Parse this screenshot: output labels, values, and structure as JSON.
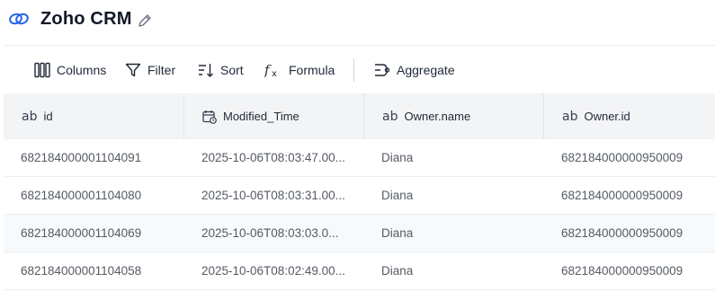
{
  "app": {
    "title": "Zoho CRM"
  },
  "toolbar": {
    "columns_label": "Columns",
    "filter_label": "Filter",
    "sort_label": "Sort",
    "formula_label": "Formula",
    "aggregate_label": "Aggregate"
  },
  "table": {
    "columns": [
      {
        "type": "ab",
        "label": "id"
      },
      {
        "type": "datetime",
        "label": "Modified_Time"
      },
      {
        "type": "ab",
        "label": "Owner.name"
      },
      {
        "type": "ab",
        "label": "Owner.id"
      }
    ],
    "rows": [
      [
        "682184000001104091",
        "2025-10-06T08:03:47.00...",
        "Diana",
        "682184000000950009"
      ],
      [
        "682184000001104080",
        "2025-10-06T08:03:31.00...",
        "Diana",
        "682184000000950009"
      ],
      [
        "682184000001104069",
        "2025-10-06T08:03:03.0...",
        "Diana",
        "682184000000950009"
      ],
      [
        "682184000001104058",
        "2025-10-06T08:02:49.00...",
        "Diana",
        "682184000000950009"
      ]
    ]
  },
  "colors": {
    "accent": "#2563eb",
    "header_bg": "#f3f4f6",
    "text": "#1f2937",
    "cell_text": "#555b63"
  }
}
